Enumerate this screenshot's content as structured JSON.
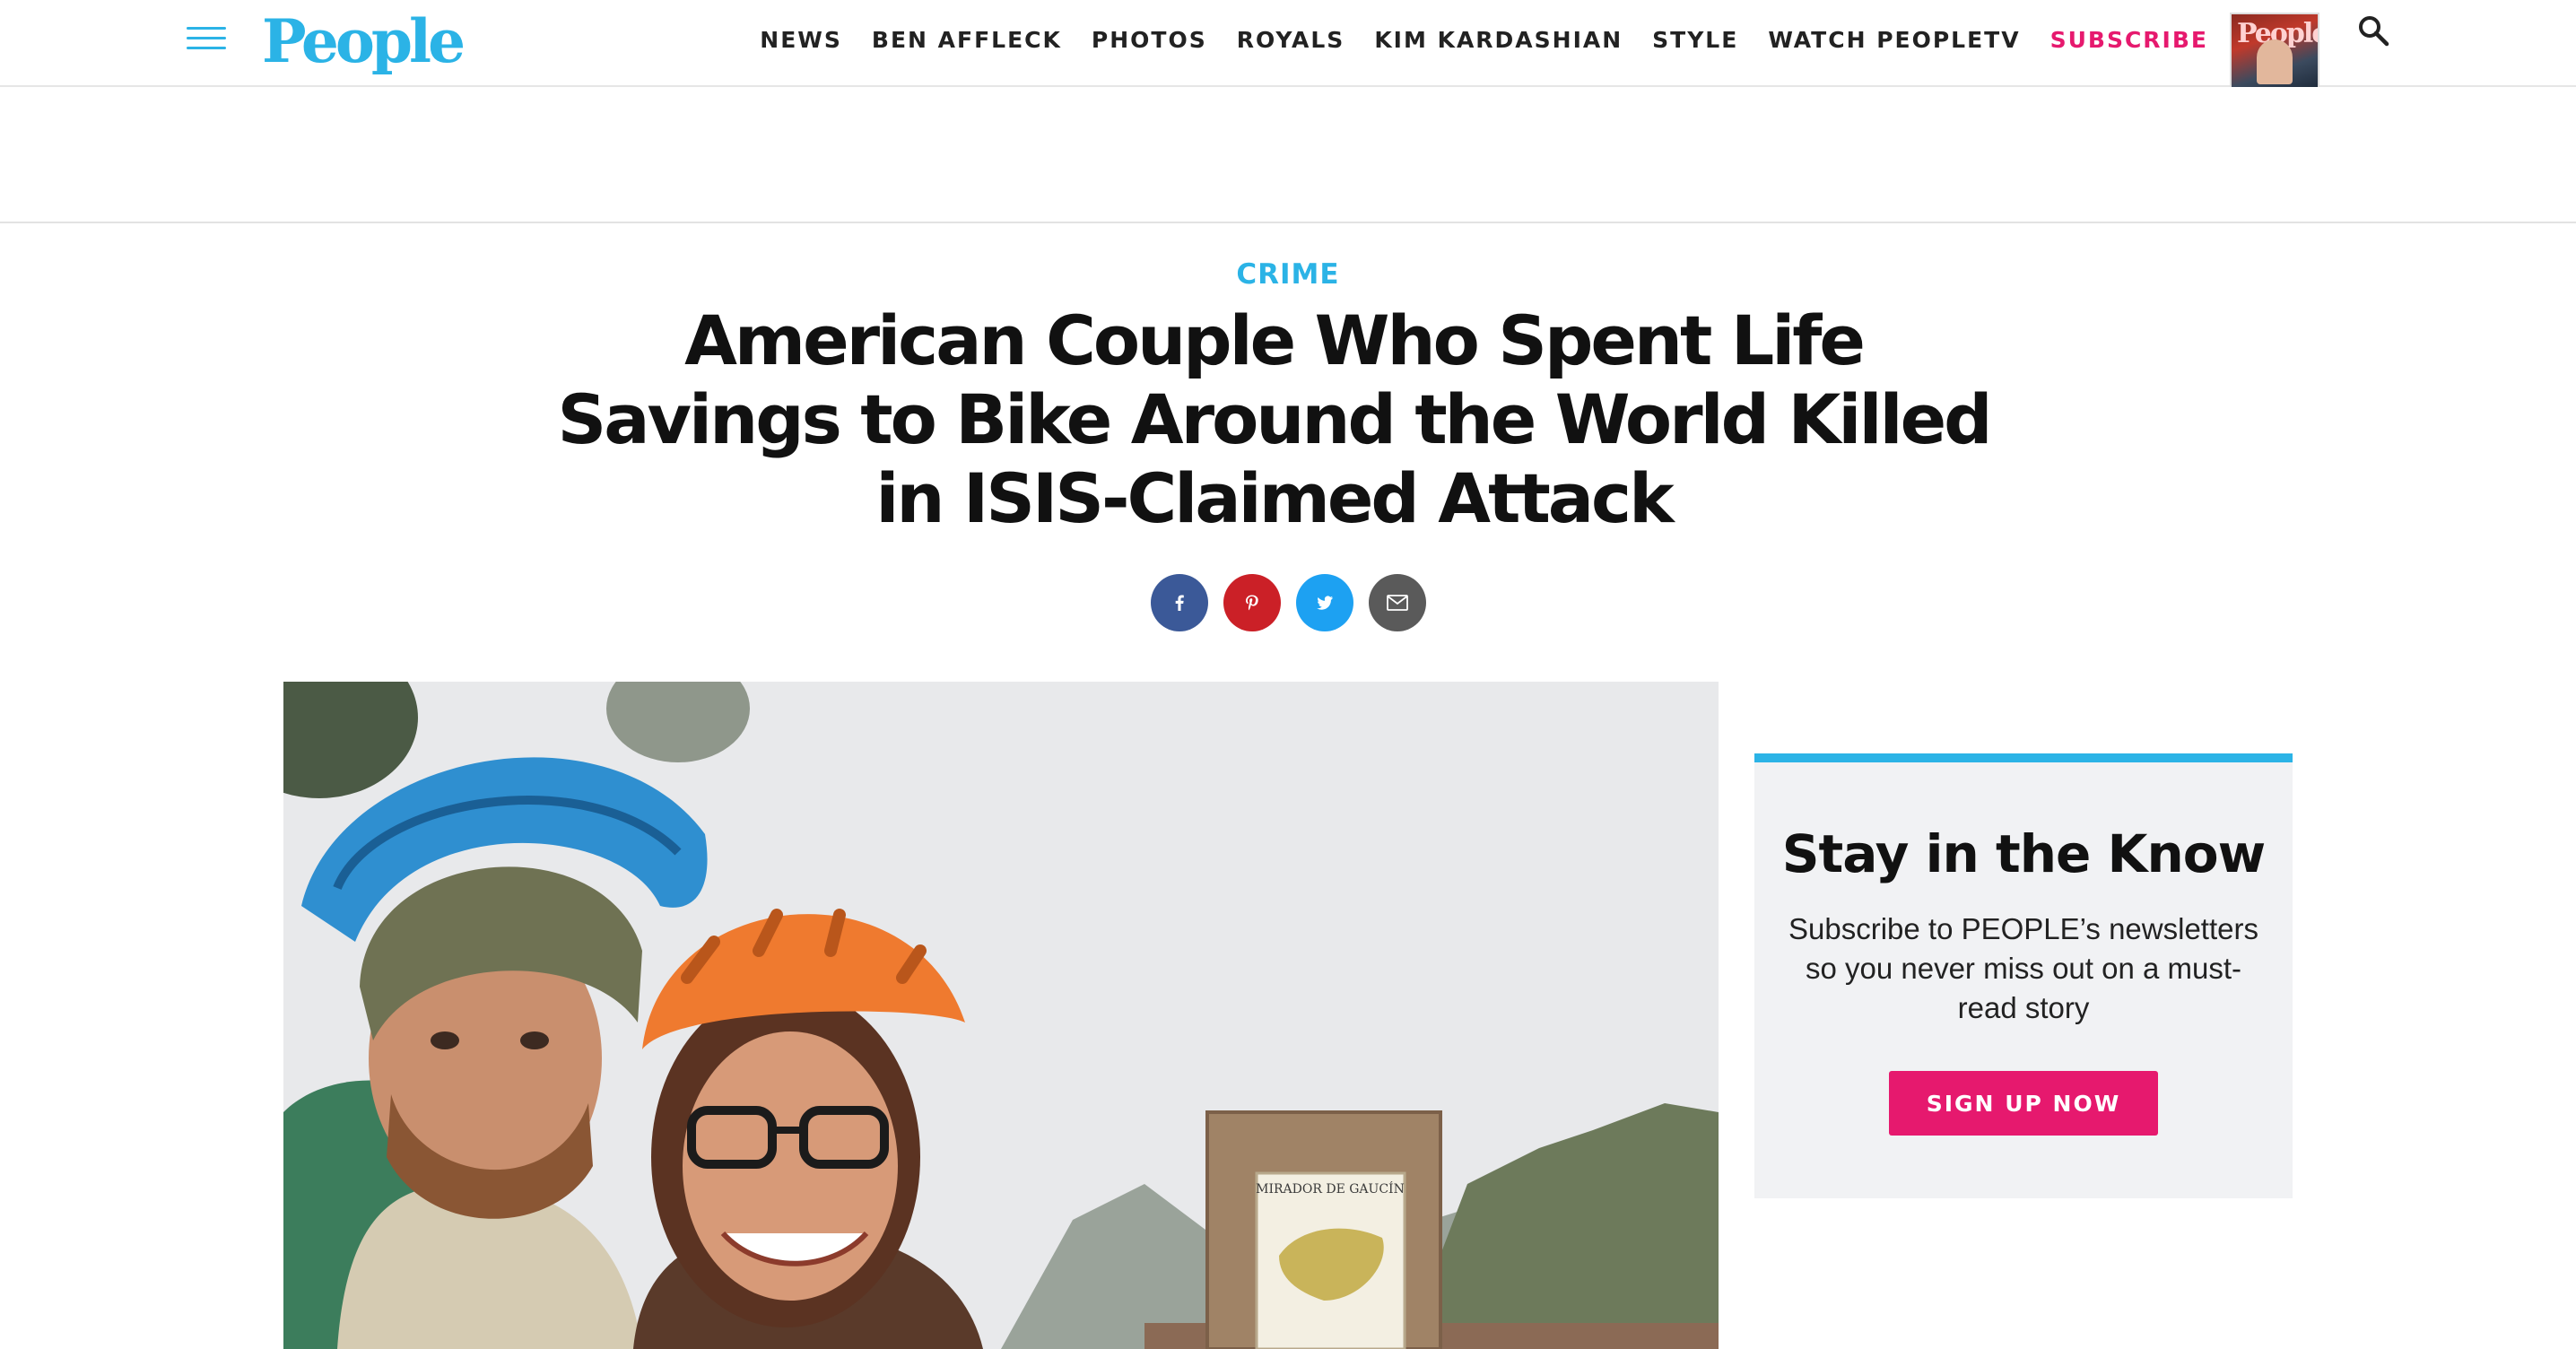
{
  "header": {
    "logo_text": "People",
    "nav": [
      {
        "label": "NEWS"
      },
      {
        "label": "BEN AFFLECK"
      },
      {
        "label": "PHOTOS"
      },
      {
        "label": "ROYALS"
      },
      {
        "label": "KIM KARDASHIAN"
      },
      {
        "label": "STYLE"
      },
      {
        "label": "WATCH PEOPLETV"
      },
      {
        "label": "SUBSCRIBE"
      }
    ],
    "magazine_cover_title": "People"
  },
  "article": {
    "category": "CRIME",
    "headline": "American Couple Who Spent Life Savings to Bike Around the World Killed in ISIS-Claimed Attack",
    "photo_sign_text": "MIRADOR DE GAUCÍN"
  },
  "share": [
    "facebook-icon",
    "pinterest-icon",
    "twitter-icon",
    "email-icon"
  ],
  "newsletter": {
    "title": "Stay in the Know",
    "text": "Subscribe to PEOPLE’s newsletters so you never miss out on a must-read story",
    "button": "SIGN UP NOW"
  },
  "colors": {
    "brand_blue": "#2bb3e6",
    "accent_pink": "#e6196e",
    "facebook": "#3b5998",
    "pinterest": "#cb2027",
    "twitter": "#1da1f2",
    "email": "#5a5a5a"
  }
}
